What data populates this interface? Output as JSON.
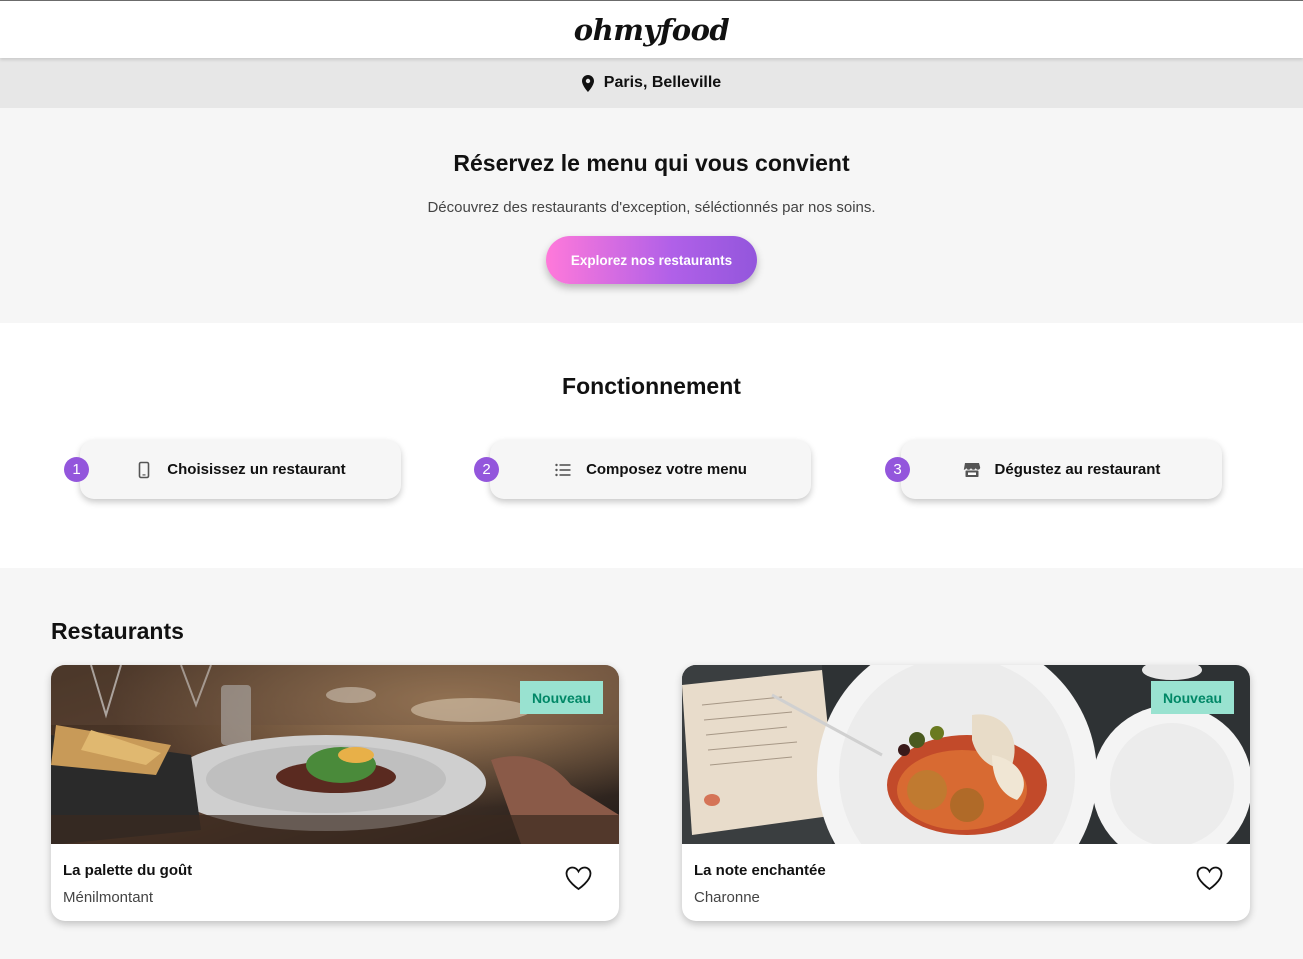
{
  "header": {
    "logo": "ohmyfood"
  },
  "location": {
    "icon": "location-pin-icon",
    "text": "Paris, Belleville"
  },
  "hero": {
    "title": "Réservez le menu qui vous convient",
    "subtitle": "Découvrez des restaurants d'exception, séléctionnés par nos soins.",
    "cta_label": "Explorez nos restaurants"
  },
  "how": {
    "title": "Fonctionnement",
    "steps": [
      {
        "number": "1",
        "icon": "mobile-phone-icon",
        "label": "Choisissez un restaurant"
      },
      {
        "number": "2",
        "icon": "list-icon",
        "label": "Composez votre menu"
      },
      {
        "number": "3",
        "icon": "store-icon",
        "label": "Dégustez au restaurant"
      }
    ]
  },
  "restaurants": {
    "title": "Restaurants",
    "cards": [
      {
        "badge": "Nouveau",
        "name": "La palette du goût",
        "area": "Ménilmontant",
        "favorite_icon": "heart-outline-icon"
      },
      {
        "badge": "Nouveau",
        "name": "La note enchantée",
        "area": "Charonne",
        "favorite_icon": "heart-outline-icon"
      }
    ]
  },
  "colors": {
    "accent_purple": "#9356dc",
    "accent_pink": "#ff79da",
    "badge_bg": "#99e2d0",
    "badge_text": "#008766",
    "section_gray": "#f6f6f6"
  }
}
